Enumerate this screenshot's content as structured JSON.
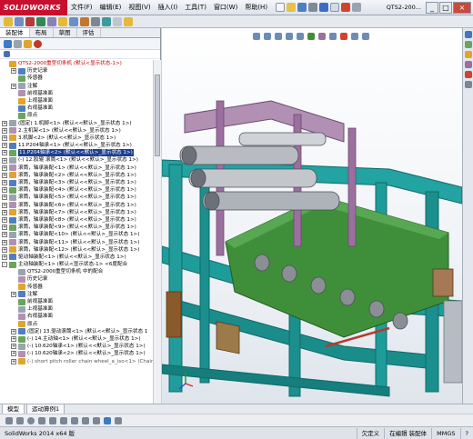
{
  "app": {
    "logo_text": "SOLIDWORKS",
    "doc_title": "QTS2-200..."
  },
  "menu": [
    "文件(F)",
    "编辑(E)",
    "视图(V)",
    "插入(I)",
    "工具(T)",
    "窗口(W)",
    "帮助(H)"
  ],
  "window_buttons": {
    "minimize": "_",
    "restore": "□",
    "close": "×"
  },
  "left_tabs": [
    "装配体",
    "布局",
    "草图",
    "评估"
  ],
  "tree": [
    {
      "label": "QTS2-2000重型切条机 (默认<显示状态-1>)",
      "style": "red",
      "indent": 0,
      "exp": ""
    },
    {
      "label": "历史记录",
      "indent": 1,
      "exp": "+"
    },
    {
      "label": "传感器",
      "indent": 1,
      "exp": ""
    },
    {
      "label": "注解",
      "indent": 1,
      "exp": "+"
    },
    {
      "label": "前视基准面",
      "indent": 1,
      "exp": ""
    },
    {
      "label": "上视基准面",
      "indent": 1,
      "exp": ""
    },
    {
      "label": "右视基准面",
      "indent": 1,
      "exp": ""
    },
    {
      "label": "原点",
      "indent": 1,
      "exp": ""
    },
    {
      "label": "(固定) 1.机脚<1> (默认<<默认>_显示状态 1>)",
      "indent": 0,
      "exp": "+"
    },
    {
      "label": "2.主机架<1> (默认<<默认>_显示状态 1>)",
      "indent": 0,
      "exp": "+"
    },
    {
      "label": "3.机脚<2> (默认<<默认>_显示状态 1>)",
      "indent": 0,
      "exp": "+"
    },
    {
      "label": "11.P204轴承<1> (默认<<默认>_显示状态 1>)",
      "indent": 0,
      "exp": "+"
    },
    {
      "label": "11.P204轴承<2> (默认<<默认>_显示状态 1>)",
      "style": "sel",
      "indent": 0,
      "exp": "+"
    },
    {
      "label": "(-) 12.胶辊 滚筒<1> (默认<<默认>_显示状态 1>)",
      "indent": 0,
      "exp": "+"
    },
    {
      "label": "滚筒，轴承装配<1> (默认<<默认>_显示状态 1>)",
      "indent": 0,
      "exp": "+"
    },
    {
      "label": "滚筒，轴承装配<2> (默认<<默认>_显示状态 1>)",
      "indent": 0,
      "exp": "+"
    },
    {
      "label": "滚筒，轴承装配<3> (默认<<默认>_显示状态 1>)",
      "indent": 0,
      "exp": "+"
    },
    {
      "label": "滚筒，轴承装配<4> (默认<<默认>_显示状态 1>)",
      "indent": 0,
      "exp": "+"
    },
    {
      "label": "滚筒，轴承装配<5> (默认<<默认>_显示状态 1>)",
      "indent": 0,
      "exp": "+"
    },
    {
      "label": "滚筒，轴承装配<6> (默认<<默认>_显示状态 1>)",
      "indent": 0,
      "exp": "+"
    },
    {
      "label": "滚筒，轴承装配<7> (默认<<默认>_显示状态 1>)",
      "indent": 0,
      "exp": "+"
    },
    {
      "label": "滚筒，轴承装配<8> (默认<<默认>_显示状态 1>)",
      "indent": 0,
      "exp": "+"
    },
    {
      "label": "滚筒，轴承装配<9> (默认<<默认>_显示状态 1>)",
      "indent": 0,
      "exp": "+"
    },
    {
      "label": "滚筒，轴承装配<10> (默认<<默认>_显示状态 1>)",
      "indent": 0,
      "exp": "+"
    },
    {
      "label": "滚筒，轴承装配<11> (默认<<默认>_显示状态 1>)",
      "indent": 0,
      "exp": "+"
    },
    {
      "label": "滚筒，轴承装配<12> (默认<<默认>_显示状态 1>)",
      "indent": 0,
      "exp": "+"
    },
    {
      "label": "驱动轴装配<1> (默认<<默认>_显示状态 1>)",
      "indent": 0,
      "exp": "+"
    },
    {
      "label": "主动轴装配<1> (默认<显示状态-1> <6度配合",
      "style": "orange",
      "indent": 0,
      "exp": "-"
    },
    {
      "label": "QTS2-2000重型切条机 中的配合",
      "indent": 1,
      "exp": ""
    },
    {
      "label": "历史记录",
      "indent": 1,
      "exp": ""
    },
    {
      "label": "传感器",
      "indent": 1,
      "exp": ""
    },
    {
      "label": "注解",
      "indent": 1,
      "exp": "+"
    },
    {
      "label": "前视基准面",
      "indent": 1,
      "exp": ""
    },
    {
      "label": "上视基准面",
      "indent": 1,
      "exp": ""
    },
    {
      "label": "右视基准面",
      "indent": 1,
      "exp": ""
    },
    {
      "label": "原点",
      "indent": 1,
      "exp": ""
    },
    {
      "label": "(固定) 13.驱动滚筒<1> (默认<<默认>_显示状态 1",
      "indent": 1,
      "exp": "+"
    },
    {
      "label": "(-) 14.主动轴<1> (默认<<默认>_显示状态 1>)",
      "indent": 1,
      "exp": "+"
    },
    {
      "label": "(-) 10.620轴承<1> (默认<<默认>_显示状态 1>)",
      "indent": 1,
      "exp": "+"
    },
    {
      "label": "(-) 10.620轴承<2> (默认<<默认>_显示状态 1>)",
      "indent": 1,
      "exp": "+"
    },
    {
      "label": "(-) short pitch roller chain wheel_a_iso<1> (Chain w",
      "style": "grey",
      "indent": 1,
      "exp": "+"
    }
  ],
  "bottom_tabs": [
    "模型",
    "运动算例1"
  ],
  "status": {
    "app_version": "SolidWorks 2014 x64 版",
    "undefined": "欠定义",
    "editing": "在编辑 装配体",
    "units": "MMGS"
  },
  "colors": {
    "accent_red": "#c8102e",
    "teal": "#1e9c9a",
    "green_belt": "#3f8f3a",
    "purple": "#9b6f9e",
    "selection": "#1c3f91"
  }
}
